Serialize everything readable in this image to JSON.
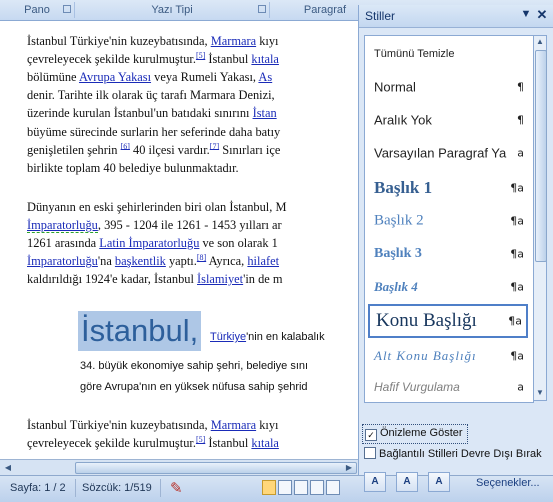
{
  "ribbon": {
    "groups": [
      {
        "label": "Pano"
      },
      {
        "label": "Yazı Tipi"
      },
      {
        "label": "Paragraf"
      }
    ]
  },
  "document": {
    "lines1": [
      {
        "parts": [
          {
            "t": "İstanbul Türkiye'nin kuzeybatısında, "
          },
          {
            "t": "Marmara",
            "link": true
          },
          {
            "t": " kıyı"
          }
        ]
      },
      {
        "parts": [
          {
            "t": "çevreleyecek şekilde kurulmuştur."
          },
          {
            "t": "[5]",
            "sup": true
          },
          {
            "t": " İstanbul "
          },
          {
            "t": "kıtala",
            "link": true
          }
        ]
      },
      {
        "parts": [
          {
            "t": "bölümüne "
          },
          {
            "t": "Avrupa Yakası",
            "link": true
          },
          {
            "t": " veya Rumeli Yakası, "
          },
          {
            "t": "As",
            "link": true
          }
        ]
      },
      {
        "parts": [
          {
            "t": "denir. Tarihte ilk olarak üç tarafı Marmara Denizi,"
          }
        ]
      },
      {
        "parts": [
          {
            "t": "üzerinde kurulan İstanbul'un batıdaki sınırını "
          },
          {
            "t": "İstan",
            "link": true
          }
        ]
      },
      {
        "parts": [
          {
            "t": "büyüme sürecinde surlarin her seferinde daha batıy"
          }
        ]
      },
      {
        "parts": [
          {
            "t": "genişletilen şehrin "
          },
          {
            "t": "[6]",
            "sup": true
          },
          {
            "t": " 40 ilçesi vardır."
          },
          {
            "t": "[7]",
            "sup": true
          },
          {
            "t": " Sınırları içe"
          }
        ]
      },
      {
        "parts": [
          {
            "t": "birlikte toplam 40 belediye bulunmaktadır."
          }
        ]
      }
    ],
    "lines2": [
      {
        "parts": [
          {
            "t": "Dünyanın en eski şehirlerinden biri olan İstanbul, M"
          }
        ]
      },
      {
        "parts": [
          {
            "t": "İmparatorluğu",
            "link": true,
            "sq": true
          },
          {
            "t": ", 395 - 1204 ile 1261 - 1453 yılları ar"
          }
        ]
      },
      {
        "parts": [
          {
            "t": "1261 arasında "
          },
          {
            "t": "Latin İmparatorluğu",
            "link": true
          },
          {
            "t": " ve son olarak 1"
          }
        ]
      },
      {
        "parts": [
          {
            "t": "İmparatorluğu",
            "link": true
          },
          {
            "t": "'na "
          },
          {
            "t": "başkentlik",
            "link": true
          },
          {
            "t": " yaptı."
          },
          {
            "t": "[8]",
            "sup": true
          },
          {
            "t": " Ayrıca, "
          },
          {
            "t": "hilafet",
            "link": true
          }
        ]
      },
      {
        "parts": [
          {
            "t": "kaldırıldığı 1924'e kadar, İstanbul "
          },
          {
            "t": "İslamiyet",
            "link": true
          },
          {
            "t": "'in de m"
          }
        ]
      }
    ],
    "big_title": "İstanbul,",
    "title_rest": [
      {
        "t": "Türkiye",
        "link": true
      },
      {
        "t": "'nin en kalabalık"
      }
    ],
    "sans_lines": [
      "34. büyük ekonomiye sahip şehri, belediye sını",
      "göre Avrupa'nın en yüksek nüfusa sahip şehrid"
    ],
    "lines3": [
      {
        "parts": [
          {
            "t": "İstanbul Türkiye'nin kuzeybatısında, "
          },
          {
            "t": "Marmara",
            "link": true
          },
          {
            "t": " kıyı"
          }
        ]
      },
      {
        "parts": [
          {
            "t": "çevreleyecek şekilde kurulmuştur."
          },
          {
            "t": "[5]",
            "sup": true
          },
          {
            "t": " İstanbul "
          },
          {
            "t": "kıtala",
            "link": true
          }
        ]
      }
    ]
  },
  "status": {
    "page": "Sayfa: 1 / 2",
    "words": "Sözcük: 1/519"
  },
  "pane": {
    "title": "Stiller",
    "pin_icon": "dropdown-arrow-icon",
    "close_icon": "close-icon",
    "styles": [
      {
        "name": "Tümünü Temizle",
        "sym": ""
      },
      {
        "name": "Normal",
        "sym": "¶"
      },
      {
        "name": "Aralık Yok",
        "sym": "¶"
      },
      {
        "name": "Varsayılan Paragraf Ya",
        "sym": "a"
      },
      {
        "name": "Başlık 1",
        "sym": "¶a"
      },
      {
        "name": "Başlık 2",
        "sym": "¶a"
      },
      {
        "name": "Başlık 3",
        "sym": "¶a"
      },
      {
        "name": "Başlık 4",
        "sym": "¶a"
      },
      {
        "name": "Konu Başlığı",
        "sym": "¶a"
      },
      {
        "name": "Alt Konu Başlığı",
        "sym": "¶a"
      },
      {
        "name": "Hafif Vurgulama",
        "sym": "a"
      }
    ],
    "preview_label": "Önizleme Göster",
    "preview_checked": true,
    "disable_linked_label": "Bağlantılı Stilleri Devre Dışı Bırak",
    "disable_linked_checked": false,
    "options_link": "Seçenekler..."
  },
  "colors": {
    "heading": "#2d5f9b",
    "link": "#1a2bb8",
    "selection": "#aec7e6",
    "accent": "#4f7fc8"
  }
}
